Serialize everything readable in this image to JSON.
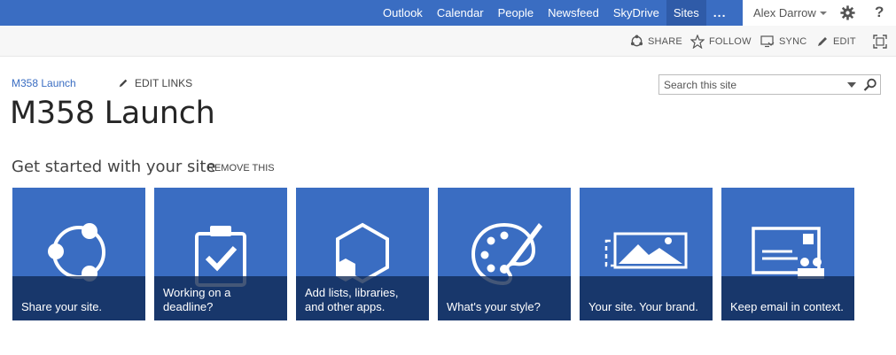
{
  "suite_nav": {
    "links": [
      "Outlook",
      "Calendar",
      "People",
      "Newsfeed",
      "SkyDrive",
      "Sites"
    ],
    "active": "Sites",
    "more": "..."
  },
  "user": {
    "name": "Alex Darrow",
    "help": "?"
  },
  "ribbon": {
    "share": "SHARE",
    "follow": "FOLLOW",
    "sync": "SYNC",
    "edit": "EDIT"
  },
  "header": {
    "breadcrumb": "M358 Launch",
    "edit_links": "EDIT LINKS",
    "title": "M358 Launch"
  },
  "search": {
    "placeholder": "Search this site",
    "value": ""
  },
  "get_started": {
    "title": "Get started with your site",
    "remove": "REMOVE THIS",
    "tiles": [
      {
        "caption": "Share your site.",
        "icon": "share-network-icon"
      },
      {
        "caption": "Working on a deadline?",
        "icon": "clipboard-check-icon"
      },
      {
        "caption": "Add lists, libraries, and other apps.",
        "icon": "hexagon-apps-icon"
      },
      {
        "caption": "What's your style?",
        "icon": "palette-brush-icon"
      },
      {
        "caption": "Your site. Your brand.",
        "icon": "picture-landscape-icon"
      },
      {
        "caption": "Keep email in context.",
        "icon": "email-people-icon"
      }
    ]
  },
  "colors": {
    "suite_bar": "#3a6dc2",
    "tile": "#3a6dc2",
    "caption_overlay": "#102852",
    "link": "#3a6dc2"
  }
}
